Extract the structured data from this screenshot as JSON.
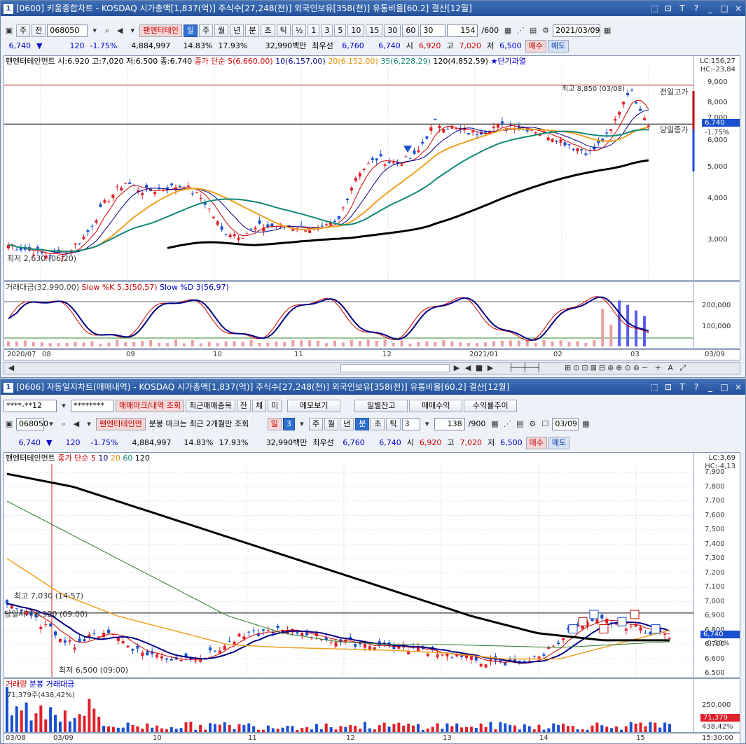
{
  "top": {
    "title": "[0600] 키움종합차트 - KOSDAQ 시가총액[1,837(억)] 주식수[27,248(천)] 외국인보유[358(천)] 유통비율[60.2] 결산[12월]",
    "win_num": "1",
    "title_icons": [
      "□",
      "⊡",
      "T",
      "?",
      "_",
      "□",
      "×"
    ],
    "toolbar": {
      "period": "주",
      "prev": "전",
      "code": "068050",
      "stock_name": "팬엔터테인",
      "periods": [
        "일",
        "주",
        "월",
        "년",
        "분",
        "초",
        "틱"
      ],
      "active_period": "일",
      "fractions": [
        "½",
        "1",
        "3",
        "5",
        "10",
        "15",
        "30",
        "60"
      ],
      "num": "30",
      "count": "154",
      "total": "/600",
      "date": "2021/03/09"
    },
    "quote": {
      "price": "6,740",
      "arrow": "▼",
      "change": "120",
      "pct": "-1.75%",
      "volume": "4,884,997",
      "rate1": "14.83%",
      "rate2": "17.93%",
      "amount": "32,990백만",
      "best": "최우선",
      "ask": "6,760",
      "bid": "6,740",
      "o_l": "시",
      "open": "6,920",
      "h_l": "고",
      "high": "7,020",
      "l_l": "저",
      "low": "6,500",
      "buy": "매수",
      "sell": "매도"
    },
    "legend": {
      "name": "팬엔터테인먼트 시:6,920 고:7,020 저:6,500 종:6,740",
      "ma_label": "종가 단순",
      "ma5": "5(6,660,00)",
      "ma10": "10(6,157,00)",
      "ma20": "20(6,152,00)",
      "ma35": "35(6,228,29)",
      "ma120": "120(4,852,59)",
      "star": "★단기과열"
    },
    "lc": "LC:156,27",
    "hc": "HC:-23,84",
    "y_labels": [
      "9,000",
      "8,000",
      "7,000",
      "6,000",
      "5,000",
      "4,000",
      "3,000"
    ],
    "annot_high": "최고 8,850 (03/08)",
    "prev_high": "전일고가",
    "today_close": "당일종가",
    "price_tag": "6,740",
    "price_tag_pct": "-1.75%",
    "annot_low": "최저 2,630 (06/20)",
    "sub_legend": {
      "a": "거래대금(32,990,00)",
      "b": "Slow %K 5,3(50,57)",
      "c": "Slow %D 3(56,97)"
    },
    "sub_y": [
      "200,000",
      "100,000"
    ],
    "x_labels": [
      "2020/07",
      "08",
      "09",
      "10",
      "11",
      "12",
      "2021/01",
      "02",
      "03"
    ],
    "x_right": "03/09"
  },
  "bottom": {
    "title": "[0606] 자동일지차트(매매내역) - KOSDAQ 시가총액[1,837(억)] 주식수[27,248(천)] 외국인보유[358(천)] 유통비율[60.2] 결산[12월]",
    "win_num": "1",
    "acct": "****-**12",
    "pw": "********",
    "buttons": [
      "매매마크/내역 조회",
      "최근매매종목",
      "잔",
      "체",
      "미",
      "메모보기",
      "일별잔고",
      "매매수익",
      "수익률추이"
    ],
    "toolbar": {
      "code": "068050",
      "stock_name": "팬엔터테인먼",
      "notice": "분봉 마크는 최근 2개월만 조회",
      "periods": [
        "일",
        "3",
        "주",
        "월",
        "년",
        "분",
        "초",
        "틱"
      ],
      "num": "3",
      "count": "138",
      "total": "/900",
      "date": "03/09"
    },
    "quote": {
      "price": "6,740",
      "arrow": "▼",
      "change": "120",
      "pct": "-1.75%",
      "volume": "4,884,997",
      "rate1": "14.83%",
      "rate2": "17.93%",
      "amount": "32,990백만",
      "best": "최우선",
      "ask": "6,760",
      "bid": "6,740",
      "o_l": "시",
      "open": "6,920",
      "h_l": "고",
      "high": "7,020",
      "l_l": "저",
      "low": "6,500",
      "buy": "매수",
      "sell": "매도"
    },
    "legend": {
      "name": "팬엔터테인먼트",
      "ma_label": "종가 단순",
      "ma5": "5",
      "ma10": "10",
      "ma20": "20",
      "ma60": "60",
      "ma120": "120"
    },
    "lc": "LC:3,69",
    "hc": "HC:-4,13",
    "y_labels": [
      "7,900",
      "7,800",
      "7,700",
      "7,600",
      "7,500",
      "7,400",
      "7,300",
      "7,200",
      "7,100",
      "7,000",
      "6,900",
      "6,800",
      "6,700",
      "6,600",
      "6,500"
    ],
    "annot_high": "최고 7,030 (14:57)",
    "annot_open": "당일시가 6,920 (09:00)",
    "annot_low": "최저 6,500 (09:00)",
    "price_tag": "6,740",
    "price_tag_pct": "-0.30%",
    "sub_legend": {
      "a": "거래량",
      "b": "분봉 거래대금",
      "c": "71,379주(438,42%)"
    },
    "sub_y": "250,000",
    "sub_tag": "71,379",
    "sub_tag_pct": "438,42%",
    "x_labels": [
      "03/08",
      "03/09",
      "10",
      "11",
      "12",
      "13",
      "14",
      "15"
    ],
    "x_right": "15:30:00"
  },
  "colors": {
    "up": "#e0202a",
    "down": "#1a4fd0",
    "ma5": "#d00000",
    "ma10": "#000088",
    "ma20": "#f0a020",
    "ma35": "#118877",
    "ma120": "#000000"
  }
}
